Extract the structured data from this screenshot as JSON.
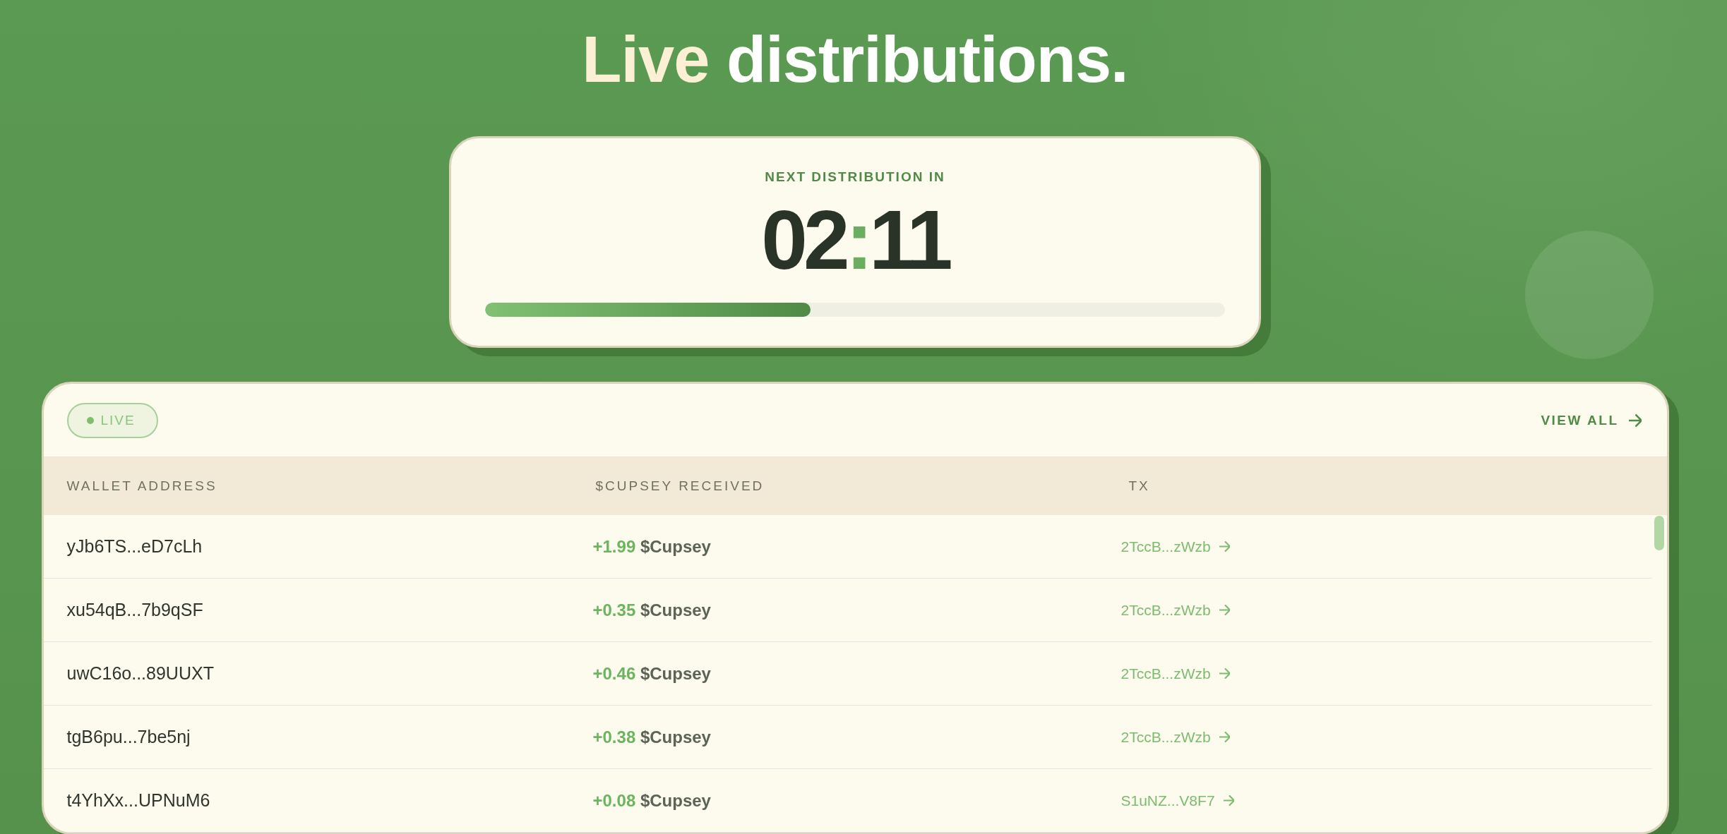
{
  "title": [
    {
      "text": "Live",
      "accent": true
    },
    {
      "text": "distributions.",
      "accent": false
    }
  ],
  "countdown_card": {
    "label": "NEXT DISTRIBUTION IN",
    "timer": {
      "minutes": "02",
      "separator": ":",
      "seconds": "11"
    },
    "progress": {
      "level": 0.44
    }
  },
  "distributions_table": {
    "badge": "LIVE",
    "view_all": "VIEW ALL",
    "columns": [
      "WALLET ADDRESS",
      "$CUPSEY RECEIVED",
      "TX"
    ],
    "rows": [
      {
        "wallet": "yJb6TS...eD7cLh",
        "amount": "+1.99",
        "token": "$Cupsey",
        "tx": "2TccB...zWzb"
      },
      {
        "wallet": "xu54qB...7b9qSF",
        "amount": "+0.35",
        "token": "$Cupsey",
        "tx": "2TccB...zWzb"
      },
      {
        "wallet": "uwC16o...89UUXT",
        "amount": "+0.46",
        "token": "$Cupsey",
        "tx": "2TccB...zWzb"
      },
      {
        "wallet": "tgB6pu...7be5nj",
        "amount": "+0.38",
        "token": "$Cupsey",
        "tx": "2TccB...zWzb"
      },
      {
        "wallet": "t4YhXx...UPNuM6",
        "amount": "+0.08",
        "token": "$Cupsey",
        "tx": "S1uNZ...V8F7"
      }
    ]
  }
}
